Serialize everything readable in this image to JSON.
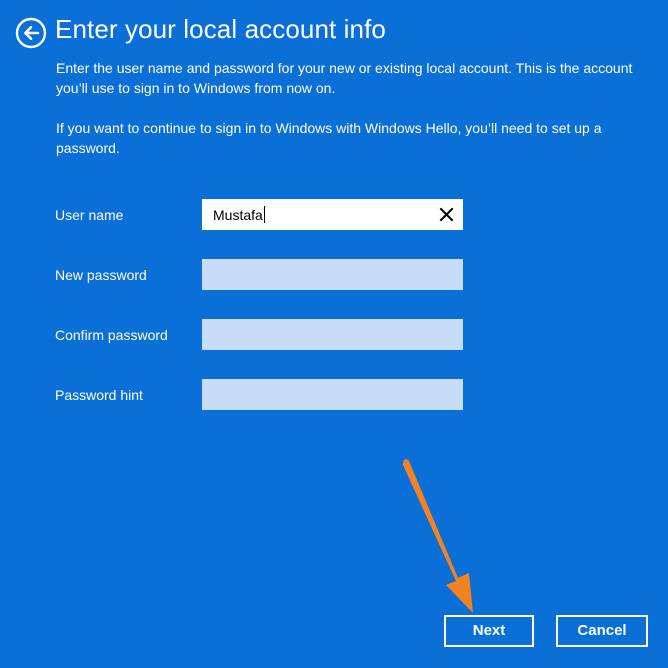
{
  "header": {
    "title": "Enter your local account info"
  },
  "description": {
    "paragraph_1": "Enter the user name and password for your new or existing local account. This is the account you’ll use to sign in to Windows from now on.",
    "paragraph_2": "If you want to continue to sign in to Windows with Windows Hello, you’ll need to set up a password."
  },
  "form": {
    "username_label": "User name",
    "username_value": "Mustafa",
    "new_password_label": "New password",
    "new_password_value": "",
    "confirm_password_label": "Confirm password",
    "confirm_password_value": "",
    "password_hint_label": "Password hint",
    "password_hint_value": ""
  },
  "buttons": {
    "next_label": "Next",
    "cancel_label": "Cancel"
  },
  "icons": {
    "back": "back-arrow-icon",
    "clear": "close-icon"
  },
  "colors": {
    "background": "#0a6fd6",
    "text": "#ffffff",
    "empty_input": "#c7dcf6",
    "annotation_arrow": "#f58220"
  }
}
